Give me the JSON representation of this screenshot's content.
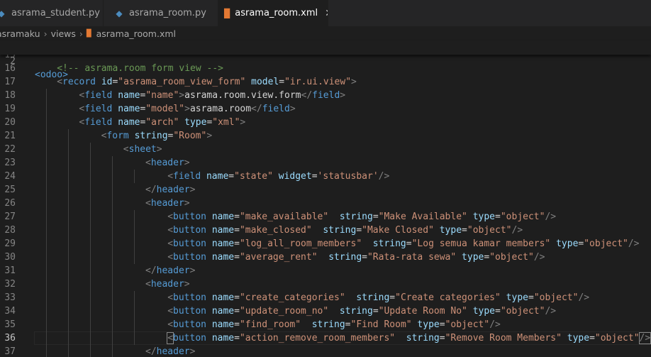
{
  "tabs": [
    {
      "label": "asrama_student.py",
      "icon": "python-icon",
      "active": false
    },
    {
      "label": "asrama_room.py",
      "icon": "python-icon",
      "active": false
    },
    {
      "label": "asrama_room.xml",
      "icon": "rss-icon",
      "active": true,
      "close": "✕"
    }
  ],
  "breadcrumb": [
    "asramaku",
    "views",
    "asrama_room.xml"
  ],
  "sticky": {
    "line_no": "2",
    "text": "<odoo>"
  },
  "lines": [
    {
      "no": "15",
      "indent": 0,
      "tokens": []
    },
    {
      "no": "16",
      "indent": 2,
      "tokens": [
        [
          "cmt",
          "<!-- asrama.room form view -->"
        ]
      ]
    },
    {
      "no": "17",
      "indent": 2,
      "tokens": [
        [
          "ang",
          "<"
        ],
        [
          "tag",
          "record"
        ],
        [
          "txt",
          " "
        ],
        [
          "attr",
          "id"
        ],
        [
          "eq",
          "="
        ],
        [
          "str",
          "\"asrama_room_view_form\""
        ],
        [
          "txt",
          " "
        ],
        [
          "attr",
          "model"
        ],
        [
          "eq",
          "="
        ],
        [
          "str",
          "\"ir.ui.view\""
        ],
        [
          "ang",
          ">"
        ]
      ]
    },
    {
      "no": "18",
      "indent": 4,
      "tokens": [
        [
          "ang",
          "<"
        ],
        [
          "tag",
          "field"
        ],
        [
          "txt",
          " "
        ],
        [
          "attr",
          "name"
        ],
        [
          "eq",
          "="
        ],
        [
          "str",
          "\"name\""
        ],
        [
          "ang",
          ">"
        ],
        [
          "txt",
          "asrama.room.view.form"
        ],
        [
          "ang",
          "</"
        ],
        [
          "tag",
          "field"
        ],
        [
          "ang",
          ">"
        ]
      ]
    },
    {
      "no": "19",
      "indent": 4,
      "tokens": [
        [
          "ang",
          "<"
        ],
        [
          "tag",
          "field"
        ],
        [
          "txt",
          " "
        ],
        [
          "attr",
          "name"
        ],
        [
          "eq",
          "="
        ],
        [
          "str",
          "\"model\""
        ],
        [
          "ang",
          ">"
        ],
        [
          "txt",
          "asrama.room"
        ],
        [
          "ang",
          "</"
        ],
        [
          "tag",
          "field"
        ],
        [
          "ang",
          ">"
        ]
      ]
    },
    {
      "no": "20",
      "indent": 4,
      "tokens": [
        [
          "ang",
          "<"
        ],
        [
          "tag",
          "field"
        ],
        [
          "txt",
          " "
        ],
        [
          "attr",
          "name"
        ],
        [
          "eq",
          "="
        ],
        [
          "str",
          "\"arch\""
        ],
        [
          "txt",
          " "
        ],
        [
          "attr",
          "type"
        ],
        [
          "eq",
          "="
        ],
        [
          "str",
          "\"xml\""
        ],
        [
          "ang",
          ">"
        ]
      ]
    },
    {
      "no": "21",
      "indent": 6,
      "tokens": [
        [
          "ang",
          "<"
        ],
        [
          "tag",
          "form"
        ],
        [
          "txt",
          " "
        ],
        [
          "attr",
          "string"
        ],
        [
          "eq",
          "="
        ],
        [
          "str",
          "\"Room\""
        ],
        [
          "ang",
          ">"
        ]
      ]
    },
    {
      "no": "22",
      "indent": 8,
      "tokens": [
        [
          "ang",
          "<"
        ],
        [
          "tag",
          "sheet"
        ],
        [
          "ang",
          ">"
        ]
      ]
    },
    {
      "no": "23",
      "indent": 10,
      "tokens": [
        [
          "ang",
          "<"
        ],
        [
          "tag",
          "header"
        ],
        [
          "ang",
          ">"
        ]
      ]
    },
    {
      "no": "24",
      "indent": 12,
      "tokens": [
        [
          "ang",
          "<"
        ],
        [
          "tag",
          "field"
        ],
        [
          "txt",
          " "
        ],
        [
          "attr",
          "name"
        ],
        [
          "eq",
          "="
        ],
        [
          "str",
          "\"state\""
        ],
        [
          "txt",
          " "
        ],
        [
          "attr",
          "widget"
        ],
        [
          "eq",
          "="
        ],
        [
          "str",
          "'statusbar'"
        ],
        [
          "ang",
          "/>"
        ]
      ]
    },
    {
      "no": "25",
      "indent": 10,
      "tokens": [
        [
          "ang",
          "</"
        ],
        [
          "tag",
          "header"
        ],
        [
          "ang",
          ">"
        ]
      ]
    },
    {
      "no": "26",
      "indent": 10,
      "tokens": [
        [
          "ang",
          "<"
        ],
        [
          "tag",
          "header"
        ],
        [
          "ang",
          ">"
        ]
      ]
    },
    {
      "no": "27",
      "indent": 12,
      "tokens": [
        [
          "ang",
          "<"
        ],
        [
          "tag",
          "button"
        ],
        [
          "txt",
          " "
        ],
        [
          "attr",
          "name"
        ],
        [
          "eq",
          "="
        ],
        [
          "str",
          "\"make_available\""
        ],
        [
          "txt",
          "  "
        ],
        [
          "attr",
          "string"
        ],
        [
          "eq",
          "="
        ],
        [
          "str",
          "\"Make Available\""
        ],
        [
          "txt",
          " "
        ],
        [
          "attr",
          "type"
        ],
        [
          "eq",
          "="
        ],
        [
          "str",
          "\"object\""
        ],
        [
          "ang",
          "/>"
        ]
      ]
    },
    {
      "no": "28",
      "indent": 12,
      "tokens": [
        [
          "ang",
          "<"
        ],
        [
          "tag",
          "button"
        ],
        [
          "txt",
          " "
        ],
        [
          "attr",
          "name"
        ],
        [
          "eq",
          "="
        ],
        [
          "str",
          "\"make_closed\""
        ],
        [
          "txt",
          "  "
        ],
        [
          "attr",
          "string"
        ],
        [
          "eq",
          "="
        ],
        [
          "str",
          "\"Make Closed\""
        ],
        [
          "txt",
          " "
        ],
        [
          "attr",
          "type"
        ],
        [
          "eq",
          "="
        ],
        [
          "str",
          "\"object\""
        ],
        [
          "ang",
          "/>"
        ]
      ]
    },
    {
      "no": "29",
      "indent": 12,
      "tokens": [
        [
          "ang",
          "<"
        ],
        [
          "tag",
          "button"
        ],
        [
          "txt",
          " "
        ],
        [
          "attr",
          "name"
        ],
        [
          "eq",
          "="
        ],
        [
          "str",
          "\"log_all_room_members\""
        ],
        [
          "txt",
          "  "
        ],
        [
          "attr",
          "string"
        ],
        [
          "eq",
          "="
        ],
        [
          "str",
          "\"Log semua kamar members\""
        ],
        [
          "txt",
          " "
        ],
        [
          "attr",
          "type"
        ],
        [
          "eq",
          "="
        ],
        [
          "str",
          "\"object\""
        ],
        [
          "ang",
          "/>"
        ]
      ]
    },
    {
      "no": "30",
      "indent": 12,
      "tokens": [
        [
          "ang",
          "<"
        ],
        [
          "tag",
          "button"
        ],
        [
          "txt",
          " "
        ],
        [
          "attr",
          "name"
        ],
        [
          "eq",
          "="
        ],
        [
          "str",
          "\"average_rent\""
        ],
        [
          "txt",
          "  "
        ],
        [
          "attr",
          "string"
        ],
        [
          "eq",
          "="
        ],
        [
          "str",
          "\"Rata-rata sewa\""
        ],
        [
          "txt",
          " "
        ],
        [
          "attr",
          "type"
        ],
        [
          "eq",
          "="
        ],
        [
          "str",
          "\"object\""
        ],
        [
          "ang",
          "/>"
        ]
      ]
    },
    {
      "no": "31",
      "indent": 10,
      "tokens": [
        [
          "ang",
          "</"
        ],
        [
          "tag",
          "header"
        ],
        [
          "ang",
          ">"
        ]
      ]
    },
    {
      "no": "32",
      "indent": 10,
      "tokens": [
        [
          "ang",
          "<"
        ],
        [
          "tag",
          "header"
        ],
        [
          "ang",
          ">"
        ]
      ]
    },
    {
      "no": "33",
      "indent": 12,
      "tokens": [
        [
          "ang",
          "<"
        ],
        [
          "tag",
          "button"
        ],
        [
          "txt",
          " "
        ],
        [
          "attr",
          "name"
        ],
        [
          "eq",
          "="
        ],
        [
          "str",
          "\"create_categories\""
        ],
        [
          "txt",
          "  "
        ],
        [
          "attr",
          "string"
        ],
        [
          "eq",
          "="
        ],
        [
          "str",
          "\"Create categories\""
        ],
        [
          "txt",
          " "
        ],
        [
          "attr",
          "type"
        ],
        [
          "eq",
          "="
        ],
        [
          "str",
          "\"object\""
        ],
        [
          "ang",
          "/>"
        ]
      ]
    },
    {
      "no": "34",
      "indent": 12,
      "tokens": [
        [
          "ang",
          "<"
        ],
        [
          "tag",
          "button"
        ],
        [
          "txt",
          " "
        ],
        [
          "attr",
          "name"
        ],
        [
          "eq",
          "="
        ],
        [
          "str",
          "\"update_room_no\""
        ],
        [
          "txt",
          "  "
        ],
        [
          "attr",
          "string"
        ],
        [
          "eq",
          "="
        ],
        [
          "str",
          "\"Update Room No\""
        ],
        [
          "txt",
          " "
        ],
        [
          "attr",
          "type"
        ],
        [
          "eq",
          "="
        ],
        [
          "str",
          "\"object\""
        ],
        [
          "ang",
          "/>"
        ]
      ]
    },
    {
      "no": "35",
      "indent": 12,
      "tokens": [
        [
          "ang",
          "<"
        ],
        [
          "tag",
          "button"
        ],
        [
          "txt",
          " "
        ],
        [
          "attr",
          "name"
        ],
        [
          "eq",
          "="
        ],
        [
          "str",
          "\"find_room\""
        ],
        [
          "txt",
          "  "
        ],
        [
          "attr",
          "string"
        ],
        [
          "eq",
          "="
        ],
        [
          "str",
          "\"Find Room\""
        ],
        [
          "txt",
          " "
        ],
        [
          "attr",
          "type"
        ],
        [
          "eq",
          "="
        ],
        [
          "str",
          "\"object\""
        ],
        [
          "ang",
          "/>"
        ]
      ]
    },
    {
      "no": "36",
      "indent": 12,
      "current": true,
      "tokens": [
        [
          "ang",
          "<"
        ],
        [
          "tag",
          "button"
        ],
        [
          "txt",
          " "
        ],
        [
          "attr",
          "name"
        ],
        [
          "eq",
          "="
        ],
        [
          "str",
          "\"action_remove_room_members\""
        ],
        [
          "txt",
          "  "
        ],
        [
          "attr",
          "string"
        ],
        [
          "eq",
          "="
        ],
        [
          "str",
          "\"Remove Room Members\""
        ],
        [
          "txt",
          " "
        ],
        [
          "attr",
          "type"
        ],
        [
          "eq",
          "="
        ],
        [
          "str",
          "\"object\""
        ],
        [
          "ang",
          "/>"
        ]
      ]
    },
    {
      "no": "37",
      "indent": 10,
      "tokens": [
        [
          "ang",
          "</"
        ],
        [
          "tag",
          "header"
        ],
        [
          "ang",
          ">"
        ]
      ]
    }
  ]
}
